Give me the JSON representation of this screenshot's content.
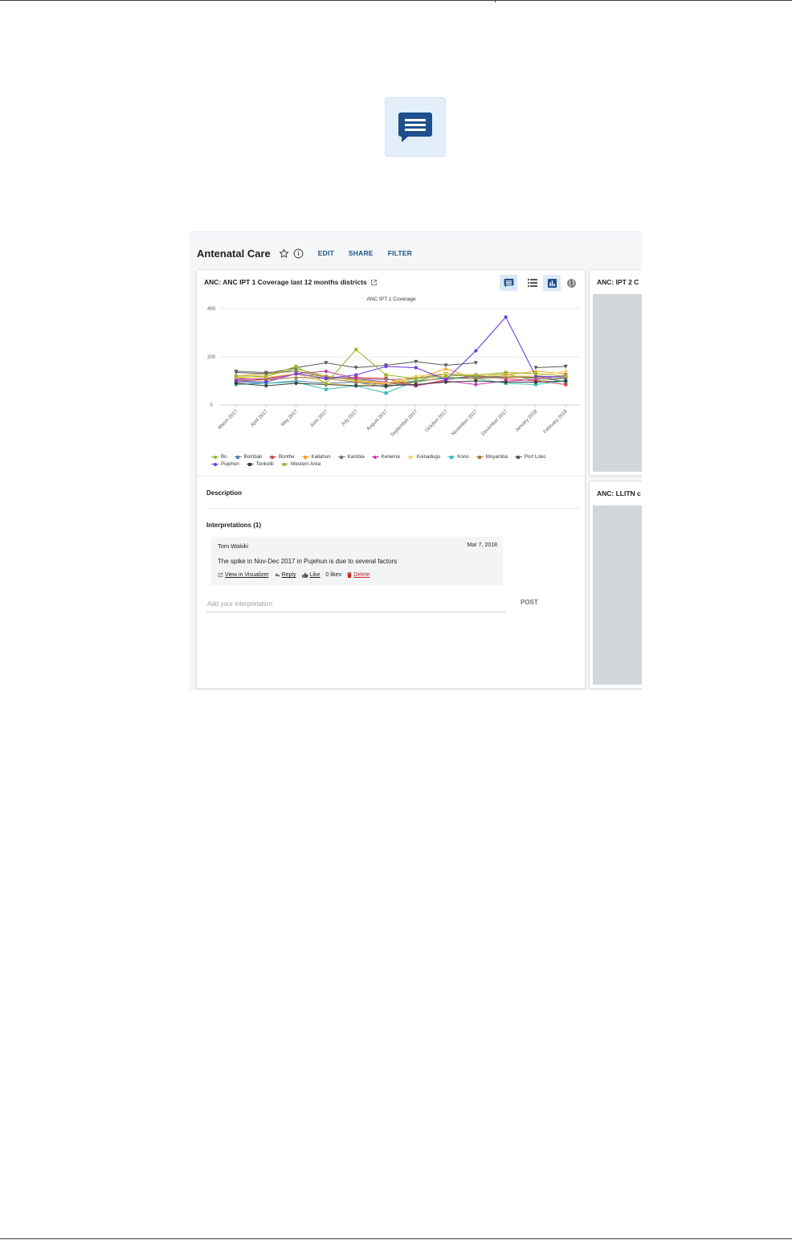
{
  "dashboard": {
    "title": "Antenatal Care",
    "actions": {
      "edit": "EDIT",
      "share": "SHARE",
      "filter": "FILTER"
    }
  },
  "main_item": {
    "title": "ANC: ANC IPT 1 Coverage last 12 months districts",
    "description_title": "Description",
    "interpretations_title": "Interpretations (1)",
    "interpretation": {
      "user": "Tom Wakiki",
      "date": "Mar 7, 2018",
      "text": "The spike in Nov-Dec 2017 in Pujehun is due to several factors",
      "view_label": "View in Visualizer",
      "reply_label": "Reply",
      "like_label": "Like",
      "likes_text": "0 likes",
      "delete_label": "Delete"
    },
    "input_placeholder": "Add your interpretation",
    "post_label": "POST"
  },
  "side_items": [
    {
      "title": "ANC: IPT 2 C"
    },
    {
      "title": "ANC: LLITN c"
    }
  ],
  "icons": {
    "page_icon": "interpretations-icon",
    "star": "star-icon",
    "info": "info-icon",
    "external": "external-link-icon",
    "table": "table-icon",
    "chart": "chart-icon",
    "map": "globe-icon"
  },
  "chart_data": {
    "type": "line",
    "title": "ANC IPT 1 Coverage",
    "categories": [
      "March 2017",
      "April 2017",
      "May 2017",
      "June 2017",
      "July 2017",
      "August 2017",
      "September 2017",
      "October 2017",
      "November 2017",
      "December 2017",
      "January 2018",
      "February 2018"
    ],
    "yticks": [
      0,
      200,
      400
    ],
    "ylim": [
      0,
      400
    ],
    "grid": true,
    "legend_position": "bottom",
    "series": [
      {
        "name": "Bo",
        "color": "#8db52c",
        "marker": "circle",
        "values": [
          110,
          120,
          150,
          120,
          105,
          90,
          100,
          130,
          120,
          130,
          100,
          110
        ]
      },
      {
        "name": "Bombali",
        "color": "#5280a8",
        "marker": "diamond",
        "values": [
          95,
          90,
          100,
          90,
          95,
          75,
          100,
          110,
          120,
          115,
          120,
          95
        ]
      },
      {
        "name": "Bonthe",
        "color": "#e0434f",
        "marker": "square",
        "values": [
          110,
          105,
          130,
          110,
          115,
          110,
          80,
          105,
          120,
          110,
          100,
          85
        ]
      },
      {
        "name": "Kailahun",
        "color": "#f5a623",
        "marker": "star",
        "values": [
          120,
          130,
          140,
          120,
          100,
          90,
          110,
          150,
          110,
          125,
          140,
          130
        ]
      },
      {
        "name": "Kambia",
        "color": "#7b7b7b",
        "marker": "triangle-down",
        "values": [
          140,
          135,
          140,
          115,
          110,
          105,
          110,
          130,
          115,
          120,
          110,
          110
        ]
      },
      {
        "name": "Kenema",
        "color": "#c23ba1",
        "marker": "circle",
        "values": [
          105,
          110,
          130,
          140,
          110,
          95,
          80,
          100,
          85,
          100,
          105,
          125
        ]
      },
      {
        "name": "Koinadugu",
        "color": "#f7d25c",
        "marker": "diamond",
        "values": [
          115,
          115,
          130,
          90,
          80,
          90,
          120,
          130,
          125,
          120,
          120,
          140
        ]
      },
      {
        "name": "Kono",
        "color": "#3fbfae",
        "marker": "square",
        "values": [
          85,
          90,
          95,
          65,
          80,
          50,
          100,
          110,
          110,
          90,
          85,
          100
        ]
      },
      {
        "name": "Moyamba",
        "color": "#a07d3a",
        "marker": "triangle",
        "values": [
          100,
          105,
          115,
          110,
          95,
          85,
          95,
          115,
          110,
          115,
          115,
          120
        ]
      },
      {
        "name": "Port Loko",
        "color": "#5b5b5b",
        "marker": "triangle-down",
        "values": [
          135,
          130,
          155,
          175,
          155,
          165,
          180,
          165,
          175,
          null,
          155,
          160
        ]
      },
      {
        "name": "Pujehun",
        "color": "#6a3ce0",
        "marker": "circle",
        "values": [
          100,
          95,
          130,
          110,
          125,
          160,
          155,
          105,
          225,
          365,
          120,
          115
        ]
      },
      {
        "name": "Tonkolili",
        "color": "#3a3a3a",
        "marker": "diamond",
        "values": [
          90,
          80,
          90,
          85,
          80,
          80,
          85,
          95,
          100,
          95,
          95,
          100
        ]
      },
      {
        "name": "Western Area",
        "color": "#a5b531",
        "marker": "square",
        "values": [
          120,
          120,
          160,
          90,
          230,
          125,
          110,
          120,
          125,
          135,
          130,
          120
        ]
      }
    ]
  }
}
